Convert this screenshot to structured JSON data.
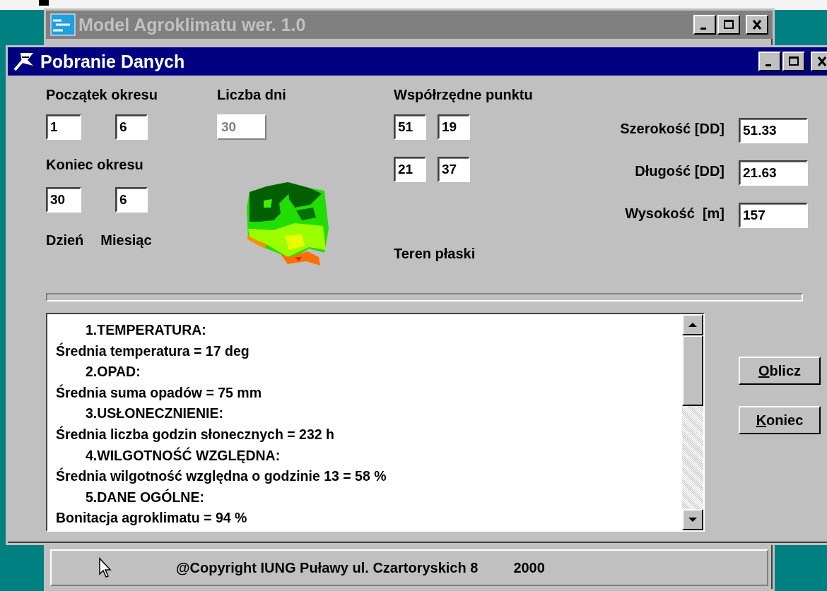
{
  "main_window": {
    "title": "Model Agroklimatu wer. 1.0",
    "active": false
  },
  "dialog": {
    "title": "Pobranie Danych",
    "active": true
  },
  "period": {
    "start_label": "Początek okresu",
    "start_day": "1",
    "start_month": "6",
    "end_label": "Koniec okresu",
    "end_day": "30",
    "end_month": "6",
    "day_label": "Dzień",
    "month_label": "Miesiąc"
  },
  "days": {
    "label": "Liczba dni",
    "value": "30",
    "disabled": true
  },
  "coordinates": {
    "label": "Współrzędne punktu",
    "lat_deg": "51",
    "lat_min": "19",
    "lon_deg": "21",
    "lon_min": "37",
    "terrain": "Teren płaski"
  },
  "location": [
    {
      "label": "Szerokość [DD]",
      "value": "51.33"
    },
    {
      "label": "Długość [DD]",
      "value": "21.63"
    },
    {
      "label": "Wysokość  [m]",
      "value": "157"
    }
  ],
  "results": [
    {
      "kind": "heading",
      "text": "1.TEMPERATURA:"
    },
    {
      "kind": "value",
      "text": "Średnia temperatura = 17 deg"
    },
    {
      "kind": "heading",
      "text": "2.OPAD:"
    },
    {
      "kind": "value",
      "text": "Średnia suma opadów = 75 mm"
    },
    {
      "kind": "heading",
      "text": "3.USŁONECZNIENIE:"
    },
    {
      "kind": "value",
      "text": "Średnia liczba godzin słonecznych = 232 h"
    },
    {
      "kind": "heading",
      "text": "4.WILGOTNOŚĆ WZGLĘDNA:"
    },
    {
      "kind": "value",
      "text": "Średnia wilgotność względna o godzinie 13 = 58 %"
    },
    {
      "kind": "heading",
      "text": "5.DANE OGÓLNE:"
    },
    {
      "kind": "value",
      "text": "Bonitacja agroklimatu = 94 %"
    }
  ],
  "buttons": [
    {
      "label": "Oblicz"
    },
    {
      "label": "Koniec"
    }
  ],
  "status_bar": {
    "text": "@Copyright IUNG Puławy ul. Czartoryskich 8",
    "year": "2000"
  }
}
